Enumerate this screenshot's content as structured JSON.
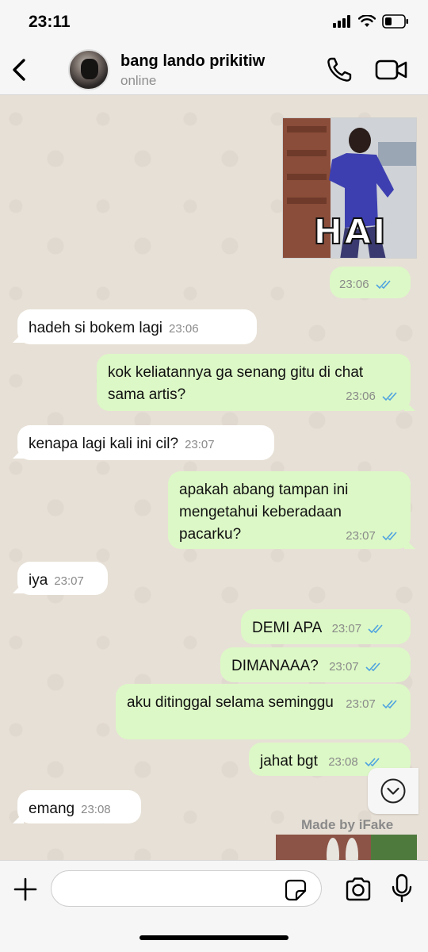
{
  "status_bar": {
    "time": "23:11"
  },
  "header": {
    "contact_name": "bang lando prikitiw",
    "contact_status": "online"
  },
  "image_sticker": {
    "caption": "HAI",
    "time": "23:06"
  },
  "messages": [
    {
      "direction": "in",
      "text": "hadeh si bokem lagi",
      "time": "23:06"
    },
    {
      "direction": "out",
      "text": "kok keliatannya ga senang gitu di chat sama artis?",
      "time": "23:06"
    },
    {
      "direction": "in",
      "text": "kenapa lagi kali ini cil?",
      "time": "23:07"
    },
    {
      "direction": "out",
      "text": "apakah abang tampan ini mengetahui keberadaan pacarku?",
      "time": "23:07"
    },
    {
      "direction": "in",
      "text": "iya",
      "time": "23:07"
    },
    {
      "direction": "out",
      "text": "DEMI APA",
      "time": "23:07"
    },
    {
      "direction": "out",
      "text": "DIMANAAA?",
      "time": "23:07"
    },
    {
      "direction": "out",
      "text": "aku ditinggal selama seminggu",
      "time": "23:07"
    },
    {
      "direction": "out",
      "text": "jahat bgt",
      "time": "23:08"
    },
    {
      "direction": "in",
      "text": "emang",
      "time": "23:08"
    }
  ],
  "watermark": "Made by iFake",
  "input": {
    "value": "",
    "placeholder": ""
  },
  "colors": {
    "outgoing_bubble": "#dcf8c6",
    "incoming_bubble": "#ffffff",
    "read_ticks": "#4fa3e0",
    "chat_background": "#e7e0d6"
  }
}
